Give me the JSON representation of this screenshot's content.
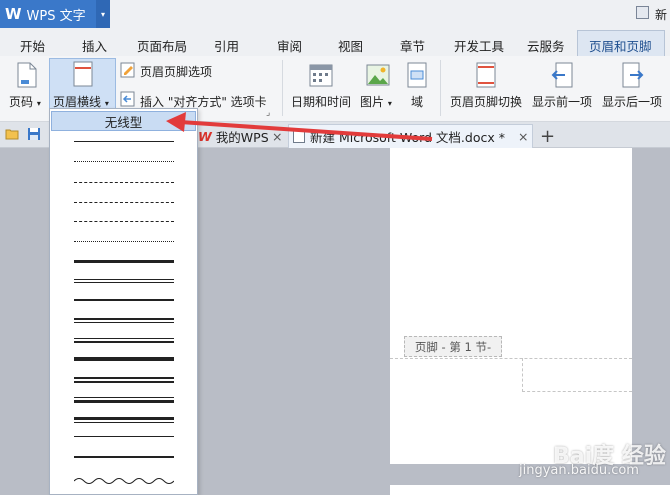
{
  "app": {
    "logo": "W",
    "title": "WPS 文字",
    "dropdown_glyph": "▾",
    "top_right_label": "新"
  },
  "menu_tabs": [
    "开始",
    "插入",
    "页面布局",
    "引用",
    "审阅",
    "视图",
    "章节",
    "开发工具",
    "云服务",
    "页眉和页脚"
  ],
  "ribbon": {
    "page_number": "页码",
    "header_line": "页眉横线",
    "header_footer_options": "页眉页脚选项",
    "insert_align_tab": "插入 \"对齐方式\" 选项卡",
    "date_time": "日期和时间",
    "picture": "图片",
    "field": "域",
    "switch_header_footer": "页眉页脚切换",
    "show_previous": "显示前一项",
    "show_next": "显示后一项",
    "drop_glyph": "▾",
    "launcher_glyph": "⌟"
  },
  "doc_tabs": {
    "tab1": "我的WPS",
    "tab2": "新建 Microsoft Word 文档.docx *",
    "close_glyph": "×",
    "add_glyph": "+"
  },
  "dropdown": {
    "none_option": "无线型"
  },
  "document": {
    "footer_label": "页脚  - 第 1 节-"
  },
  "watermark": {
    "main": "Bai度 经验",
    "url": "jingyan.baidu.com"
  },
  "colors": {
    "accent": "#3a78c9",
    "arrow": "#e23b3b",
    "active_tab": "#dde6f2",
    "selected_option": "#c9dcf3"
  }
}
